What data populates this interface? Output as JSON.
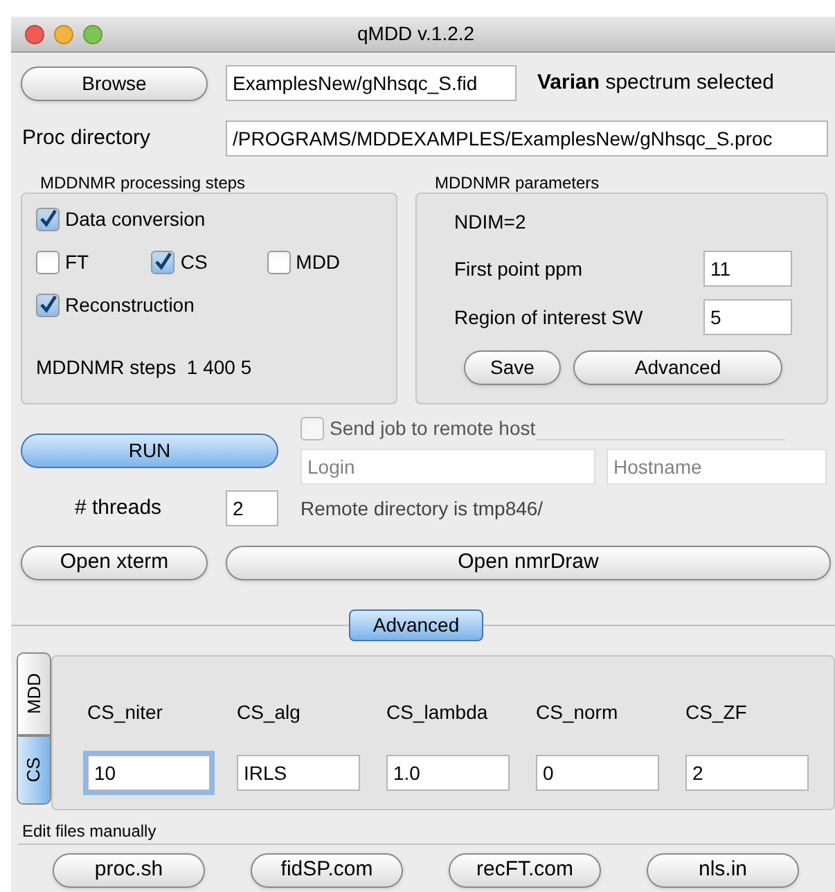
{
  "window": {
    "title": "qMDD v.1.2.2"
  },
  "file_row": {
    "browse_button": "Browse",
    "file_field": "ExamplesNew/gNhsqc_S.fid",
    "status": "**Varian** spectrum selected"
  },
  "proc_directory": {
    "label": "Proc directory",
    "value": "/PROGRAMS/MDDEXAMPLES/ExamplesNew/gNhsqc_S.proc"
  },
  "processing_steps": {
    "title": "MDDNMR processing steps",
    "checkboxes": [
      {
        "label": "Data conversion",
        "checked": true
      },
      {
        "label": "FT",
        "checked": false
      },
      {
        "label": "CS",
        "checked": true
      },
      {
        "label": "MDD",
        "checked": false
      },
      {
        "label": "Reconstruction",
        "checked": true
      }
    ],
    "steps": "MDDNMR steps  1 400 5"
  },
  "parameters": {
    "title": "MDDNMR parameters",
    "ndim": "NDIM=2",
    "fields": [
      {
        "label": "First point ppm",
        "value": "11"
      },
      {
        "label": "Region of interest SW",
        "value": "5"
      }
    ],
    "buttons": [
      "Save",
      "Advanced"
    ]
  },
  "remote": {
    "checkbox": {
      "label": "Send job to remote host",
      "checked": false,
      "disabled": true
    },
    "login_placeholder": "Login",
    "hostname_placeholder": "Hostname",
    "remote_directory": "Remote directory is tmp846/"
  },
  "run_button": "RUN",
  "threads": {
    "label": "# threads",
    "value": "2"
  },
  "open_buttons": [
    "Open xterm",
    "Open nmrDraw"
  ],
  "advanced_toggle": {
    "label": "Advanced",
    "selected": true
  },
  "side_tabs": [
    {
      "label": "MDD",
      "selected": false
    },
    {
      "label": "CS",
      "selected": true
    }
  ],
  "cs_params": [
    {
      "label": "CS_niter",
      "value": "10",
      "focused": true
    },
    {
      "label": "CS_alg",
      "value": "IRLS",
      "focused": false
    },
    {
      "label": "CS_lambda",
      "value": "1.0",
      "focused": false
    },
    {
      "label": "CS_norm",
      "value": "0",
      "focused": false
    },
    {
      "label": "CS_ZF",
      "value": "2",
      "focused": false
    }
  ],
  "edit_files": {
    "title": "Edit files manually",
    "buttons": [
      "proc.sh",
      "fidSP.com",
      "recFT.com",
      "nls.in"
    ]
  }
}
